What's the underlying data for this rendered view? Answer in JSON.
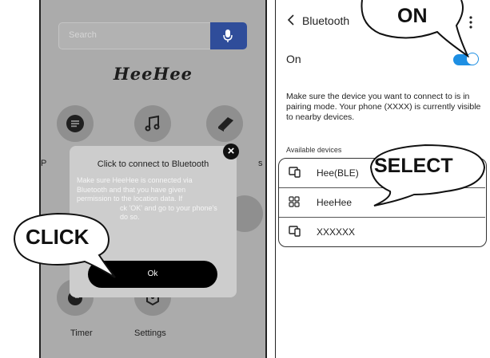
{
  "left_screen": {
    "search_placeholder": "Search",
    "brand": "HeeHee",
    "menu": {
      "label_p": "P",
      "label_s": "s",
      "timer": "Timer",
      "settings": "Settings"
    },
    "icons": [
      "chat-icon",
      "music-note-icon",
      "book-icon",
      "timer-icon",
      "settings-icon"
    ],
    "dialog": {
      "title": "Click to connect to Bluetooth",
      "body_line_1": "Make sure HeeHee is connected via",
      "body_line_2": "Bluetooth and that you have given",
      "body_line_3": "permission to the location data. If",
      "body_line_4": "ck 'OK' and go to your phone's",
      "body_line_5": "do so.",
      "ok_label": "Ok",
      "close_glyph": "×"
    }
  },
  "right_screen": {
    "title": "Bluetooth",
    "toggle_label": "On",
    "toggle_on": true,
    "info": "Make sure the device you want to connect to is in pairing mode. Your phone (XXXX) is currently visible to nearby devices.",
    "section_label": "Available devices",
    "devices": [
      {
        "name": "Hee(BLE)",
        "icon": "phone-device-icon"
      },
      {
        "name": "HeeHee",
        "icon": "grid-device-icon"
      },
      {
        "name": "XXXXXX",
        "icon": "phone-device-icon"
      }
    ]
  },
  "callouts": {
    "on": "ON",
    "select": "SELECT",
    "click": "CLICK"
  },
  "colors": {
    "accent_blue": "#1e8fe3",
    "mic_blue": "#2f4d9a"
  }
}
